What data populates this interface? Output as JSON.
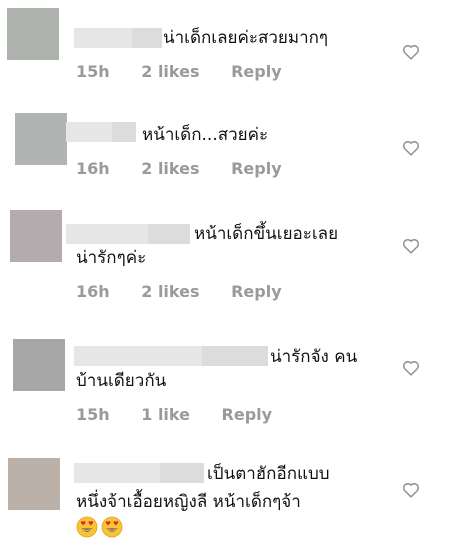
{
  "comments": [
    {
      "text_lines": [
        "น่าเด็กเลยค่ะสวยมากๆ"
      ],
      "time": "15h",
      "likes": "2 likes",
      "reply": "Reply",
      "avatar_color": "#adb2ad"
    },
    {
      "text_lines": [
        "หน้าเด็ก...สวยค่ะ"
      ],
      "time": "16h",
      "likes": "2 likes",
      "reply": "Reply",
      "avatar_color": "#b0b4b2"
    },
    {
      "text_lines": [
        "หน้าเด็กขึ้นเยอะเลย",
        "น่ารักๆค่ะ"
      ],
      "time": "16h",
      "likes": "2 likes",
      "reply": "Reply",
      "avatar_color": "#b4abae"
    },
    {
      "text_lines": [
        "น่ารักจัง คน",
        "บ้านเดียวกัน"
      ],
      "time": "15h",
      "likes": "1 like",
      "reply": "Reply",
      "avatar_color": "#a8a7a7"
    },
    {
      "text_lines": [
        "เป็นตาฮักอีกแบบ",
        "หนึ่งจ้าเอื้อยหญิงลี หน้าเด็กๆจ้า"
      ],
      "emojis": [
        "heart-eyes-emoji",
        "heart-eyes-emoji"
      ],
      "avatar_color": "#bcb1a8"
    }
  ]
}
